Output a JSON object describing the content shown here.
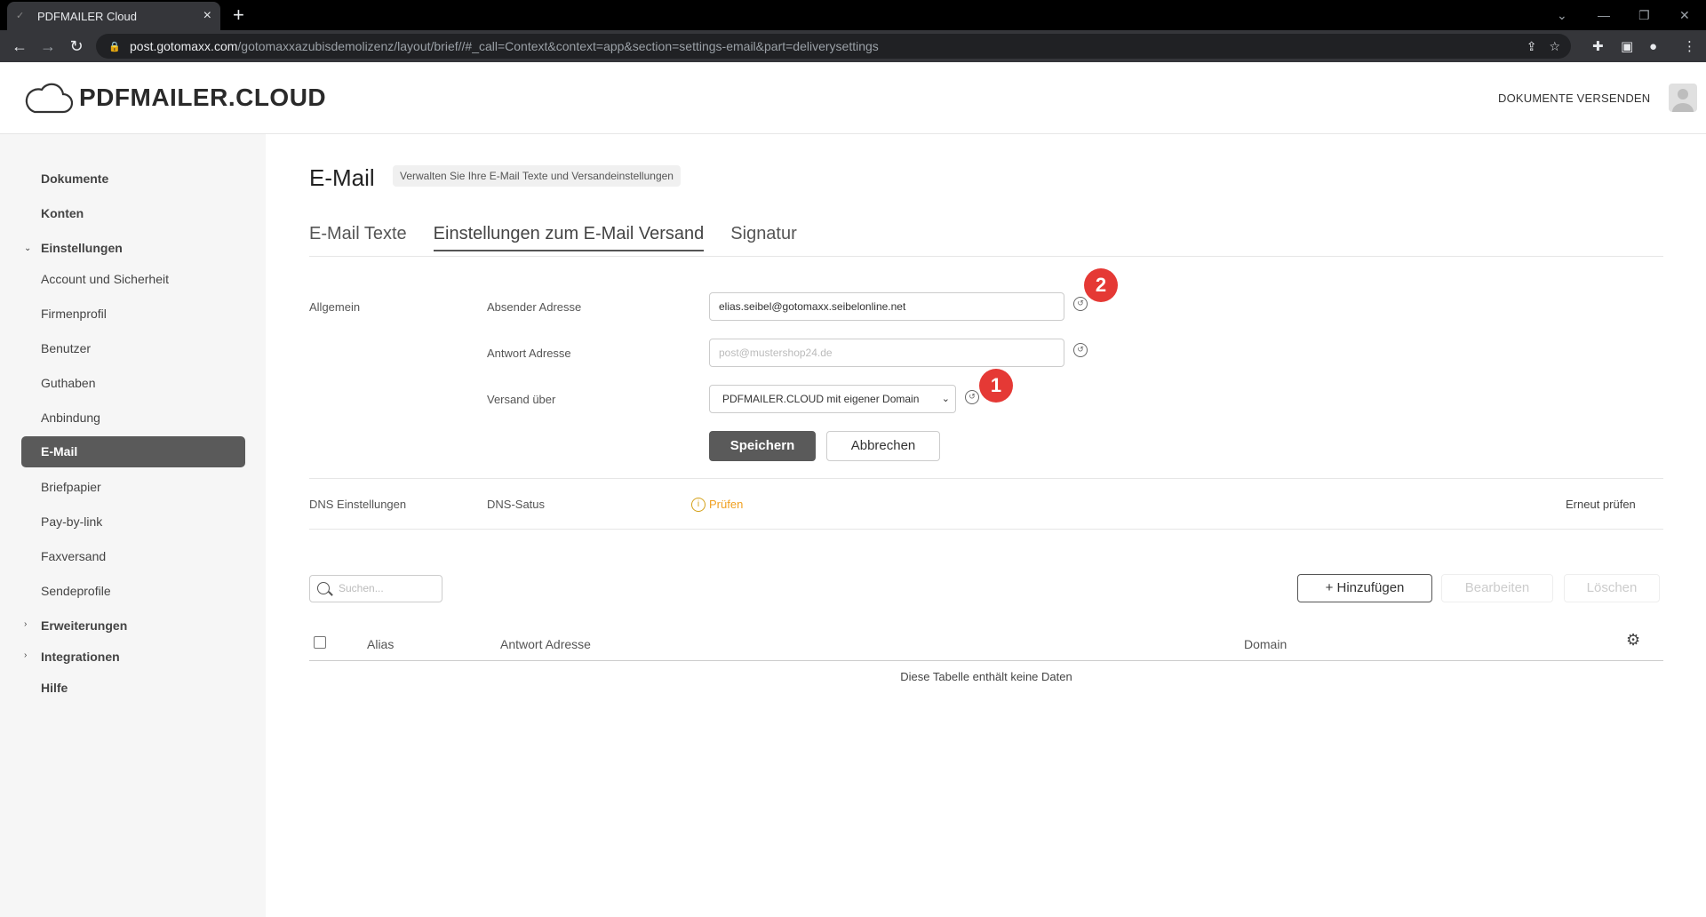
{
  "browser": {
    "tab_title": "PDFMAILER Cloud",
    "url_host": "post.gotomaxx.com",
    "url_path": "/gotomaxxazubisdemolizenz/layout/brief//#_call=Context&context=app&section=settings-email&part=deliverysettings"
  },
  "header": {
    "logo_text": "PDFMAILER.CLOUD",
    "send_documents": "DOKUMENTE VERSENDEN"
  },
  "sidebar": {
    "items": [
      {
        "label": "Dokumente"
      },
      {
        "label": "Konten"
      },
      {
        "label": "Einstellungen"
      },
      {
        "label": "Account und Sicherheit"
      },
      {
        "label": "Firmenprofil"
      },
      {
        "label": "Benutzer"
      },
      {
        "label": "Guthaben"
      },
      {
        "label": "Anbindung"
      },
      {
        "label": "E-Mail"
      },
      {
        "label": "Briefpapier"
      },
      {
        "label": "Pay-by-link"
      },
      {
        "label": "Faxversand"
      },
      {
        "label": "Sendeprofile"
      },
      {
        "label": "Erweiterungen"
      },
      {
        "label": "Integrationen"
      },
      {
        "label": "Hilfe"
      }
    ]
  },
  "page": {
    "title": "E-Mail",
    "subtitle": "Verwalten Sie Ihre E-Mail Texte und Versandeinstellungen",
    "tabs": [
      {
        "label": "E-Mail Texte"
      },
      {
        "label": "Einstellungen zum E-Mail Versand"
      },
      {
        "label": "Signatur"
      }
    ]
  },
  "general": {
    "section_label": "Allgemein",
    "sender_label": "Absender Adresse",
    "sender_value": "elias.seibel@gotomaxx.seibelonline.net",
    "reply_label": "Antwort Adresse",
    "reply_placeholder": "post@mustershop24.de",
    "via_label": "Versand über",
    "via_value": "PDFMAILER.CLOUD mit eigener Domain",
    "save": "Speichern",
    "cancel": "Abbrechen",
    "badge_1": "1",
    "badge_2": "2"
  },
  "dns": {
    "section_label": "DNS Einstellungen",
    "status_label": "DNS-Satus",
    "status_value": "Prüfen",
    "recheck": "Erneut prüfen"
  },
  "table": {
    "search_placeholder": "Suchen...",
    "add": "+ Hinzufügen",
    "edit": "Bearbeiten",
    "delete": "Löschen",
    "columns": [
      "Alias",
      "Antwort Adresse",
      "Domain"
    ],
    "empty_text": "Diese Tabelle enthält keine Daten"
  }
}
